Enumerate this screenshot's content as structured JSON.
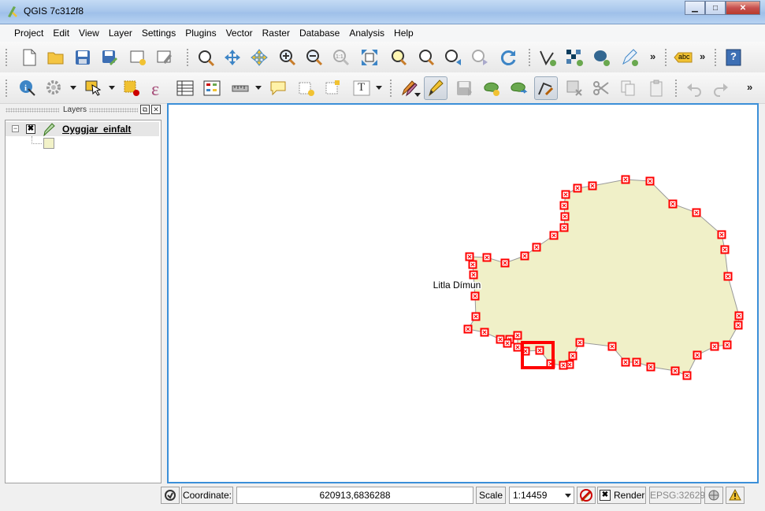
{
  "window": {
    "title": "QGIS 7c312f8",
    "minimize_label": "▁",
    "maximize_label": "□",
    "close_label": "✕"
  },
  "menu": [
    "Project",
    "Edit",
    "View",
    "Layer",
    "Settings",
    "Plugins",
    "Vector",
    "Raster",
    "Database",
    "Analysis",
    "Help"
  ],
  "toolbar1": {
    "label_tool_text": "abc",
    "help_tool_text": "?",
    "overflow": "»"
  },
  "toolbar2": {
    "text_tool_text": "T",
    "overflow": "»"
  },
  "layers_panel": {
    "title": "Layers",
    "float_label": "⧉",
    "close_label": "✕",
    "layer": {
      "expander": "−",
      "checked_mark": "✖",
      "name": "Oyggjar_einfalt",
      "fill_color": "#f2f2c8"
    }
  },
  "map": {
    "feature_label": "Litla Dímun",
    "polygon_fill": "#f0f0c8",
    "vertex_color": "#ff0000"
  },
  "status": {
    "coordinate_label": "Coordinate:",
    "coordinate_value": "620913,6836288",
    "scale_label": "Scale",
    "scale_value": "1:14459",
    "render_checkbox": "✖",
    "render_label": "Render",
    "crs_label": "EPSG:32629"
  }
}
